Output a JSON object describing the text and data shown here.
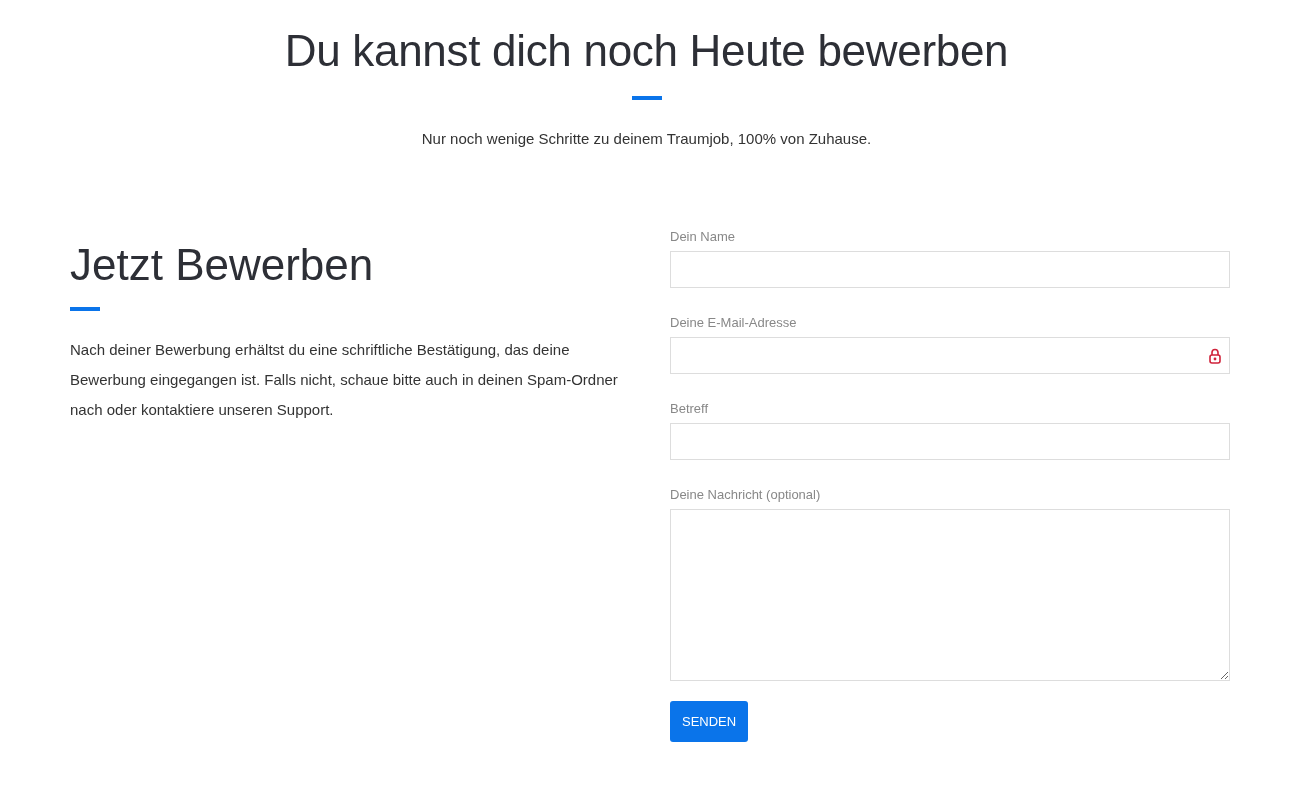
{
  "hero": {
    "title": "Du kannst dich noch Heute bewerben",
    "subtitle": "Nur noch wenige Schritte zu deinem Traumjob, 100% von Zuhause."
  },
  "intro": {
    "heading": "Jetzt Bewerben",
    "text": "Nach deiner Bewerbung erhältst du eine schriftliche Bestätigung, das deine Bewerbung eingegangen ist. Falls nicht, schaue bitte auch in deinen Spam-Ordner nach oder kontaktiere unseren Support."
  },
  "form": {
    "fields": [
      {
        "label": "Dein Name",
        "kind": "input",
        "lock_icon": false
      },
      {
        "label": "Deine E-Mail-Adresse",
        "kind": "input",
        "lock_icon": true
      },
      {
        "label": "Betreff",
        "kind": "input",
        "lock_icon": false
      },
      {
        "label": "Deine Nachricht (optional)",
        "kind": "textarea"
      }
    ],
    "submit": "SENDEN"
  }
}
